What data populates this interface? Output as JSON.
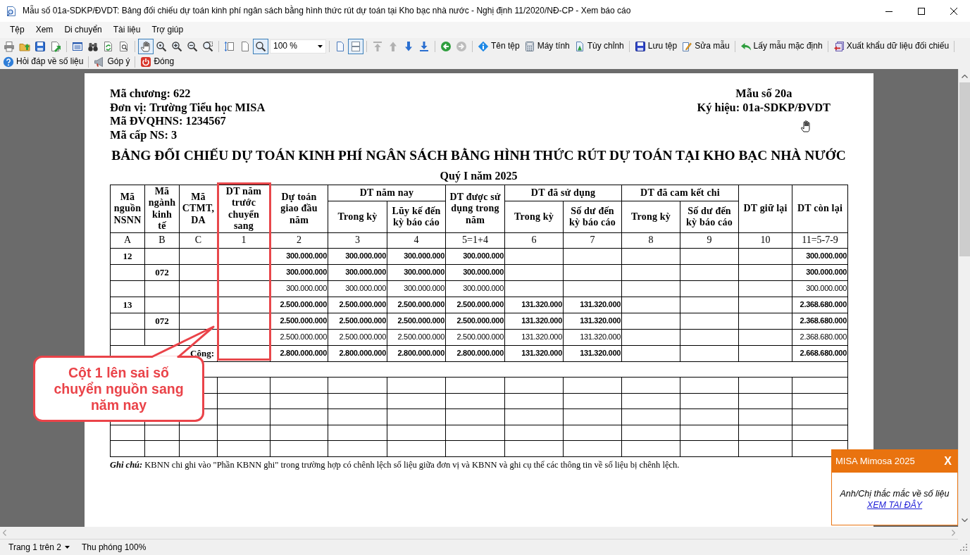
{
  "window": {
    "title": "Mẫu số 01a-SDKP/ĐVDT: Bảng đối chiếu dự toán kinh phí ngân sách bằng hình thức rút dự toán tại Kho bạc nhà nước - Nghị định 11/2020/NĐ-CP - Xem báo cáo"
  },
  "menu": [
    "Tệp",
    "Xem",
    "Di chuyển",
    "Tài liệu",
    "Trợ giúp"
  ],
  "toolbar": {
    "groups": [
      [
        {
          "kind": "button",
          "selected": false,
          "disabled": false
        },
        {
          "kind": "button",
          "selected": false,
          "disabled": false
        },
        {
          "kind": "button",
          "selected": false,
          "disabled": false
        },
        {
          "kind": "button",
          "selected": false,
          "disabled": false
        }
      ],
      [
        {
          "kind": "button",
          "selected": false,
          "disabled": false
        },
        {
          "kind": "button",
          "selected": false,
          "disabled": false
        },
        {
          "kind": "button",
          "selected": false,
          "disabled": false
        },
        {
          "kind": "button",
          "selected": false,
          "disabled": false
        }
      ],
      [
        {
          "kind": "button",
          "selected": true,
          "disabled": false
        },
        {
          "kind": "button",
          "selected": false,
          "disabled": false
        },
        {
          "kind": "button",
          "selected": false,
          "disabled": false
        },
        {
          "kind": "button",
          "selected": false,
          "disabled": false
        },
        {
          "kind": "button",
          "selected": false,
          "disabled": false
        }
      ],
      [
        {
          "kind": "button",
          "selected": false,
          "disabled": false
        },
        {
          "kind": "button",
          "selected": false,
          "disabled": false
        },
        {
          "kind": "button",
          "selected": true,
          "disabled": false
        },
        {
          "kind": "combo",
          "value": "100 %",
          "selected": false,
          "disabled": false
        }
      ],
      [
        {
          "kind": "button",
          "selected": false,
          "disabled": false
        },
        {
          "kind": "button",
          "selected": true,
          "disabled": false
        }
      ],
      [
        {
          "kind": "button",
          "selected": false,
          "disabled": true
        },
        {
          "kind": "button",
          "selected": false,
          "disabled": true
        },
        {
          "kind": "button",
          "selected": false,
          "disabled": false
        },
        {
          "kind": "button",
          "selected": false,
          "disabled": false
        }
      ],
      [
        {
          "kind": "button",
          "selected": false,
          "disabled": false
        },
        {
          "kind": "button",
          "selected": false,
          "disabled": true
        }
      ],
      [
        {
          "kind": "button",
          "label": "Tên tệp",
          "selected": false,
          "disabled": false
        },
        {
          "kind": "button",
          "label": "Máy tính",
          "selected": false,
          "disabled": false
        },
        {
          "kind": "button",
          "label": "Tùy chỉnh",
          "selected": false,
          "disabled": false
        }
      ],
      [
        {
          "kind": "button",
          "label": "Lưu tệp",
          "selected": false,
          "disabled": false
        },
        {
          "kind": "button",
          "label": "Sửa mẫu",
          "selected": false,
          "disabled": false
        }
      ],
      [
        {
          "kind": "button",
          "label": "Lấy mẫu mặc định",
          "selected": false,
          "disabled": false
        }
      ],
      [
        {
          "kind": "button",
          "label": "Xuất khẩu dữ liệu đối chiếu",
          "selected": false,
          "disabled": false
        }
      ]
    ]
  },
  "toolbar_2": [
    {
      "label": "Hỏi đáp về số liệu"
    },
    {
      "label": "Góp ý"
    },
    {
      "label": "Đóng"
    }
  ],
  "report": {
    "info": [
      "Mã chương: 622",
      "Đơn vị: Trường Tiểu học MISA",
      "Mã ĐVQHNS: 1234567",
      "Mã cấp NS: 3"
    ],
    "form": [
      "Mẫu số 20a",
      "Ký hiệu: 01a-SDKP/ĐVDT"
    ],
    "title": "BẢNG ĐỐI CHIẾU DỰ TOÁN KINH PHÍ NGÂN SÁCH BẰNG HÌNH THỨC RÚT DỰ TOÁN TẠI KHO BẠC NHÀ NƯỚC",
    "period": "Quý I năm 2025",
    "table": {
      "columns": [
        {
          "label": "Mã nguồn NSNN",
          "highlighted": false
        },
        {
          "label": "Mã ngành kinh tế",
          "highlighted": false
        },
        {
          "label": "Mã CTMT, DA",
          "highlighted": false
        },
        {
          "label": "DT năm trước chuyển sang",
          "highlighted": true
        },
        {
          "label": "Dự toán giao đầu năm",
          "highlighted": false
        },
        {
          "label": "DT năm nay",
          "highlighted": false,
          "children": [
            {
              "label": "Trong kỳ",
              "highlighted": false
            },
            {
              "label": "Lũy kế đến kỳ báo cáo",
              "highlighted": false
            }
          ]
        },
        {
          "label": "DT được sử dụng trong năm",
          "highlighted": false
        },
        {
          "label": "DT đã sử dụng",
          "highlighted": false,
          "children": [
            {
              "label": "Trong kỳ",
              "highlighted": false
            },
            {
              "label": "Số dư đến kỳ báo cáo",
              "highlighted": false
            }
          ]
        },
        {
          "label": "DT đã cam kết chi",
          "highlighted": false,
          "children": [
            {
              "label": "Trong kỳ",
              "highlighted": false
            },
            {
              "label": "Số dư đến kỳ báo cáo",
              "highlighted": false
            }
          ]
        },
        {
          "label": "DT giữ lại",
          "highlighted": false
        },
        {
          "label": "DT còn lại",
          "highlighted": false
        }
      ],
      "codes": [
        "A",
        "B",
        "C",
        "1",
        "2",
        "3",
        "4",
        "5=1+4",
        "6",
        "7",
        "8",
        "9",
        "10",
        "11=5-7-9"
      ],
      "rows": [
        {
          "kind": "group",
          "cells": [
            "12",
            null,
            null,
            null,
            "300.000.000",
            "300.000.000",
            "300.000.000",
            "300.000.000",
            null,
            null,
            null,
            null,
            null,
            "300.000.000"
          ]
        },
        {
          "kind": "group",
          "cells": [
            null,
            "072",
            null,
            null,
            "300.000.000",
            "300.000.000",
            "300.000.000",
            "300.000.000",
            null,
            null,
            null,
            null,
            null,
            "300.000.000"
          ]
        },
        {
          "kind": "detail",
          "cells": [
            null,
            null,
            null,
            null,
            "300.000.000",
            "300.000.000",
            "300.000.000",
            "300.000.000",
            null,
            null,
            null,
            null,
            null,
            "300.000.000"
          ]
        },
        {
          "kind": "group",
          "cells": [
            "13",
            null,
            null,
            null,
            "2.500.000.000",
            "2.500.000.000",
            "2.500.000.000",
            "2.500.000.000",
            "131.320.000",
            "131.320.000",
            null,
            null,
            null,
            "2.368.680.000"
          ]
        },
        {
          "kind": "group",
          "cells": [
            null,
            "072",
            null,
            null,
            "2.500.000.000",
            "2.500.000.000",
            "2.500.000.000",
            "2.500.000.000",
            "131.320.000",
            "131.320.000",
            null,
            null,
            null,
            "2.368.680.000"
          ]
        },
        {
          "kind": "detail",
          "cells": [
            null,
            null,
            null,
            null,
            "2.500.000.000",
            "2.500.000.000",
            "2.500.000.000",
            "2.500.000.000",
            "131.320.000",
            "131.320.000",
            null,
            null,
            null,
            "2.368.680.000"
          ]
        },
        {
          "kind": "total",
          "label": "Cộng:",
          "cells": [
            null,
            "2.800.000.000",
            "2.800.000.000",
            "2.800.000.000",
            "2.800.000.000",
            "131.320.000",
            "131.320.000",
            null,
            null,
            null,
            "2.668.680.000"
          ]
        },
        {
          "kind": "spacer"
        },
        {
          "kind": "blank"
        },
        {
          "kind": "blank"
        },
        {
          "kind": "blank"
        },
        {
          "kind": "blank"
        },
        {
          "kind": "blank"
        }
      ]
    },
    "note": "**Ghi chú:** KBNN chi ghi vào \"Phần KBNN ghi\" trong trường hợp có chênh lệch số liệu giữa đơn vị và KBNN và ghi cụ thể các thông tin về số liệu bị chênh lệch."
  },
  "callout": {
    "text": "Cột 1 lên sai số chuyển nguồn sang năm nay"
  },
  "popup": {
    "title": "MISA Mimosa 2025",
    "close": "X",
    "message": "Anh/Chị thắc mắc về số liệu",
    "link": "XEM TAI ĐÂY"
  },
  "status_bar": {
    "page": "Trang 1 trên 2",
    "zoom": "Thu phóng 100%"
  }
}
